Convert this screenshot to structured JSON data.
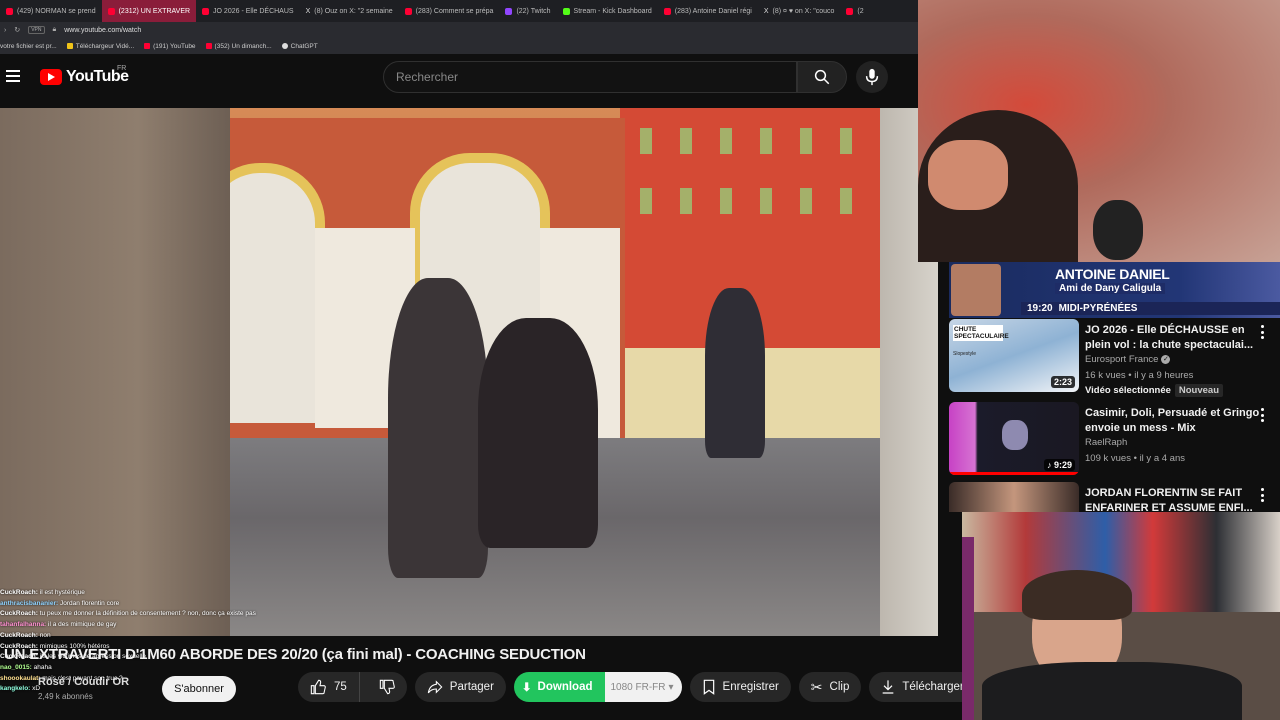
{
  "browser": {
    "tabs": [
      {
        "label": "(429) NORMAN se prend",
        "icon": "youtube-icon",
        "active": false
      },
      {
        "label": "(2312) UN EXTRAVER",
        "icon": "youtube-icon",
        "active": true
      },
      {
        "label": "JO 2026 - Elle DÉCHAUS",
        "icon": "youtube-icon",
        "active": false
      },
      {
        "label": "(8) Ouz on X: \"2 semaine",
        "icon": "x-icon",
        "active": false
      },
      {
        "label": "(283) Comment se prépa",
        "icon": "youtube-icon",
        "active": false
      },
      {
        "label": "(22) Twitch",
        "icon": "twitch-icon",
        "active": false
      },
      {
        "label": "Stream - Kick Dashboard",
        "icon": "kick-icon",
        "active": false
      },
      {
        "label": "(283) Antoine Daniel régi",
        "icon": "youtube-icon",
        "active": false
      },
      {
        "label": "(8) ¤ ♥ on X: \"couco",
        "icon": "x-icon",
        "active": false
      },
      {
        "label": "(2",
        "icon": "youtube-icon",
        "active": false
      }
    ],
    "url": "www.youtube.com/watch",
    "bookmarks": [
      {
        "label": "votre fichier est pr...",
        "icon": "none"
      },
      {
        "label": "Téléchargeur Vidé...",
        "icon": "download-icon"
      },
      {
        "label": "(191) YouTube",
        "icon": "youtube-icon"
      },
      {
        "label": "(352) Un dimanch...",
        "icon": "youtube-icon"
      },
      {
        "label": "ChatGPT",
        "icon": "chatgpt-icon"
      }
    ]
  },
  "header": {
    "logo_text": "YouTube",
    "country": "FR",
    "search_placeholder": "Rechercher"
  },
  "chat": [
    {
      "user": "CuckRoach:",
      "text": "il est hystérique"
    },
    {
      "user": "anthracisbananier:",
      "text": "Jordan florentin core"
    },
    {
      "user": "CuckRoach:",
      "text": "tu peux me donner la définition de consentement ? non, donc ça existe pas"
    },
    {
      "user": "tahanfalhanna:",
      "text": "il a des mimique de gay"
    },
    {
      "user": "CuckRoach:",
      "text": "non"
    },
    {
      "user": "CuckRoach:",
      "text": "mimiques 100% hétéros"
    },
    {
      "user": "CuckRoach:",
      "text": "ils les victimes de agression sexuelle"
    },
    {
      "user": "nao_0015:",
      "text": "ahaha"
    },
    {
      "user": "shoookaulat:",
      "text": "mais c'est payant son truc ?"
    },
    {
      "user": "kangkelo:",
      "text": "xD"
    }
  ],
  "video": {
    "title": "UN EXTRAVERTI D'1M60 ABORDE DES 20/20 (ça fini mal) - COACHING SEDUCTION",
    "channel": "Rosé / Coudir OR",
    "subscribers": "2,49 k abonnés",
    "subscribe_label": "S'abonner",
    "likes": "75",
    "share_label": "Partager",
    "download_label": "Download",
    "quality_label": "1080 FR-FR",
    "save_label": "Enregistrer",
    "clip_label": "Clip",
    "telecharger_label": "Télécharger"
  },
  "sidebar": {
    "banner": {
      "name": "ANTOINE DANIEL",
      "tagline": "Ami de Dany Caligula",
      "time": "19:20",
      "channel": "MIDI-PYRÉNÉES"
    },
    "recommendations": [
      {
        "title": "JO 2026 - Elle DÉCHAUSSE en plein vol : la chute spectaculai...",
        "channel": "Eurosport France",
        "verified": true,
        "views": "16 k vues",
        "age": "il y a 9 heures",
        "extra": "Vidéo sélectionnée",
        "badge": "Nouveau",
        "duration": "2:23",
        "thumb_text": "CHUTE SPECTACULAIRE",
        "thumb_sub": "Slopestyle"
      },
      {
        "title": "Casimir, Doli, Persuadé et Gringo envoie un mess - Mix",
        "channel": "RaelRaph",
        "verified": false,
        "views": "109 k vues",
        "age": "il y a 4 ans",
        "duration": "9:29"
      },
      {
        "title": "JORDAN FLORENTIN SE FAIT ENFARINER ET ASSUME ENFI...",
        "channel": "",
        "verified": false,
        "views": "",
        "age": ""
      }
    ]
  },
  "colors": {
    "youtube_red": "#ff0000",
    "download_green": "#22c55e",
    "background": "#0f0f0f"
  }
}
